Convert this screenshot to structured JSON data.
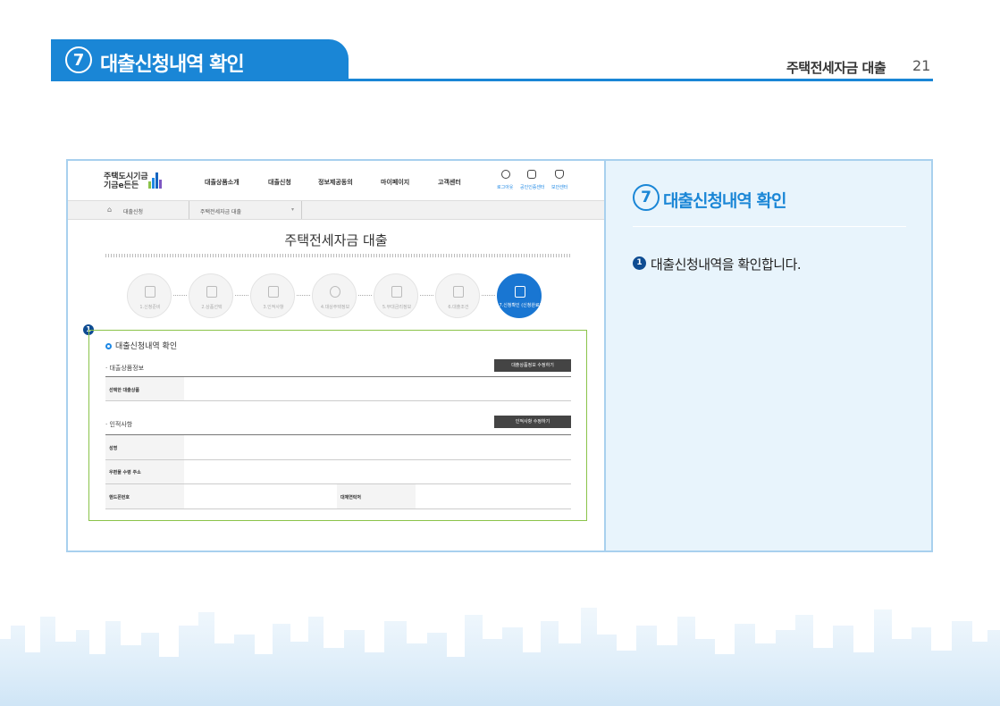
{
  "header": {
    "section_number": "7",
    "section_title": "대출신청내역 확인",
    "doc_title": "주택전세자금 대출",
    "page_number": "21",
    "accent_color": "#1a86d6"
  },
  "screenshot": {
    "logo": {
      "line1": "주택도시기금",
      "line2": "기금e든든"
    },
    "nav": [
      "대출상품소개",
      "대출신청",
      "정보제공동의",
      "마이페이지",
      "고객센터"
    ],
    "utility": [
      {
        "icon": "power-icon",
        "label": "로그아웃"
      },
      {
        "icon": "lock-icon",
        "label": "공인인증센터"
      },
      {
        "icon": "shield-icon",
        "label": "보안센터"
      }
    ],
    "breadcrumb": {
      "home_icon": "home-icon",
      "item1": "대출신청",
      "item2": "주택전세자금 대출",
      "dropdown_icon": "▾"
    },
    "page_title": "주택전세자금 대출",
    "steps": [
      {
        "label": "1.신청준비"
      },
      {
        "label": "2.상품선택"
      },
      {
        "label": "3.인적사항"
      },
      {
        "label": "4.대상주택정보"
      },
      {
        "label": "5.부대금리정보"
      },
      {
        "label": "6.대출조건"
      },
      {
        "label": "7.신청확인 (신청완료)"
      }
    ],
    "active_step_color": "#1976d2",
    "marker": "1",
    "highlight_color": "#8bc34a",
    "section_title": "대출신청내역 확인",
    "product": {
      "subheading": "· 대출상품정보",
      "edit_button": "대출상품정보 수정하기",
      "row_label": "선택한 대출상품"
    },
    "personal": {
      "subheading": "· 인적사항",
      "edit_button": "인적사항 수정하기",
      "name_label": "성명",
      "address_label": "우편물 수령 주소",
      "mobile_label": "핸드폰번호",
      "alt_contact_label": "대체연락처"
    }
  },
  "description": {
    "section_number": "7",
    "title": "대출신청내역 확인",
    "bullet_number": "1",
    "text": "대출신청내역을 확인합니다."
  }
}
